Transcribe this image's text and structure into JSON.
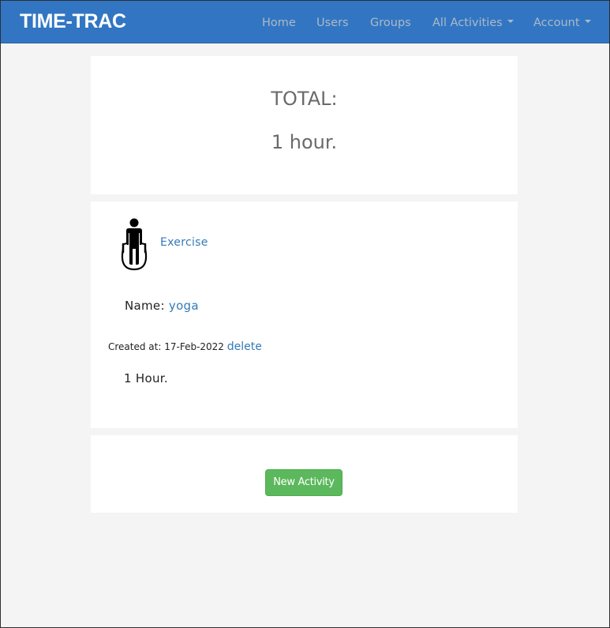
{
  "navbar": {
    "brand": "TIME-TRAC",
    "items": [
      {
        "label": "Home"
      },
      {
        "label": "Users"
      },
      {
        "label": "Groups"
      },
      {
        "label": "All Activities",
        "dropdown": true
      },
      {
        "label": "Account",
        "dropdown": true
      }
    ]
  },
  "total": {
    "label": "TOTAL:",
    "value": "1 hour."
  },
  "activity": {
    "icon": "jump-rope-person-icon",
    "category": "Exercise",
    "name_label": "Name:",
    "name_value": "yoga",
    "created_label": "Created at: 17-Feb-2022",
    "delete_label": "delete",
    "duration": "1 Hour."
  },
  "actions": {
    "new_activity_label": "New Activity"
  },
  "colors": {
    "navbar": "#3276c3",
    "link": "#337ab7",
    "success_button": "#5cb85c",
    "background": "#f4f4f4"
  }
}
